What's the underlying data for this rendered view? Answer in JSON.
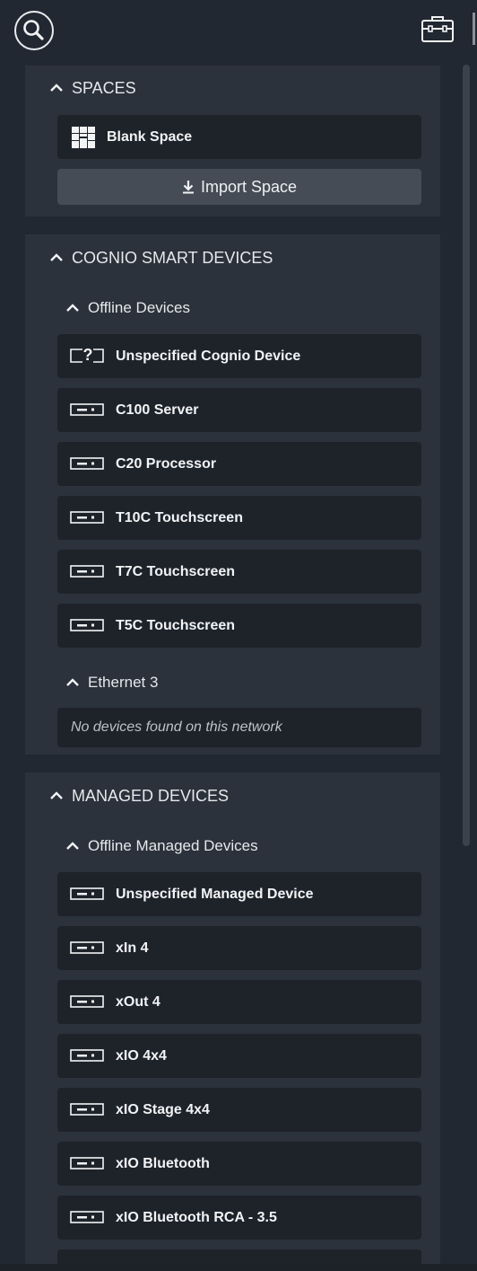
{
  "toolbar": {
    "search_icon": "search-icon",
    "toolbox_icon": "toolbox-icon"
  },
  "spaces": {
    "title": "SPACES",
    "blank_space_label": "Blank Space",
    "import_label": "Import Space"
  },
  "cognio": {
    "title": "COGNIO SMART DEVICES",
    "offline_title": "Offline Devices",
    "devices": [
      {
        "label": "Unspecified Cognio Device",
        "icon": "unknown-device-icon"
      },
      {
        "label": "C100 Server",
        "icon": "device-icon"
      },
      {
        "label": "C20 Processor",
        "icon": "device-icon"
      },
      {
        "label": "T10C Touchscreen",
        "icon": "device-icon"
      },
      {
        "label": "T7C Touchscreen",
        "icon": "device-icon"
      },
      {
        "label": "T5C Touchscreen",
        "icon": "device-icon"
      }
    ],
    "network_title": "Ethernet 3",
    "network_empty": "No devices found on this network"
  },
  "managed": {
    "title": "MANAGED DEVICES",
    "offline_title": "Offline Managed Devices",
    "devices": [
      {
        "label": "Unspecified Managed Device",
        "icon": "device-icon"
      },
      {
        "label": "xIn 4",
        "icon": "device-icon"
      },
      {
        "label": "xOut 4",
        "icon": "device-icon"
      },
      {
        "label": "xIO 4x4",
        "icon": "device-icon"
      },
      {
        "label": "xIO Stage 4x4",
        "icon": "device-icon"
      },
      {
        "label": "xIO Bluetooth",
        "icon": "device-icon"
      },
      {
        "label": "xIO Bluetooth RCA - 3.5",
        "icon": "device-icon"
      },
      {
        "label": "",
        "icon": "device-icon"
      }
    ]
  },
  "colors": {
    "background": "#222831",
    "panel": "#2b323c",
    "item": "#1e232a",
    "button": "#454c56",
    "text": "#e8eaed"
  }
}
